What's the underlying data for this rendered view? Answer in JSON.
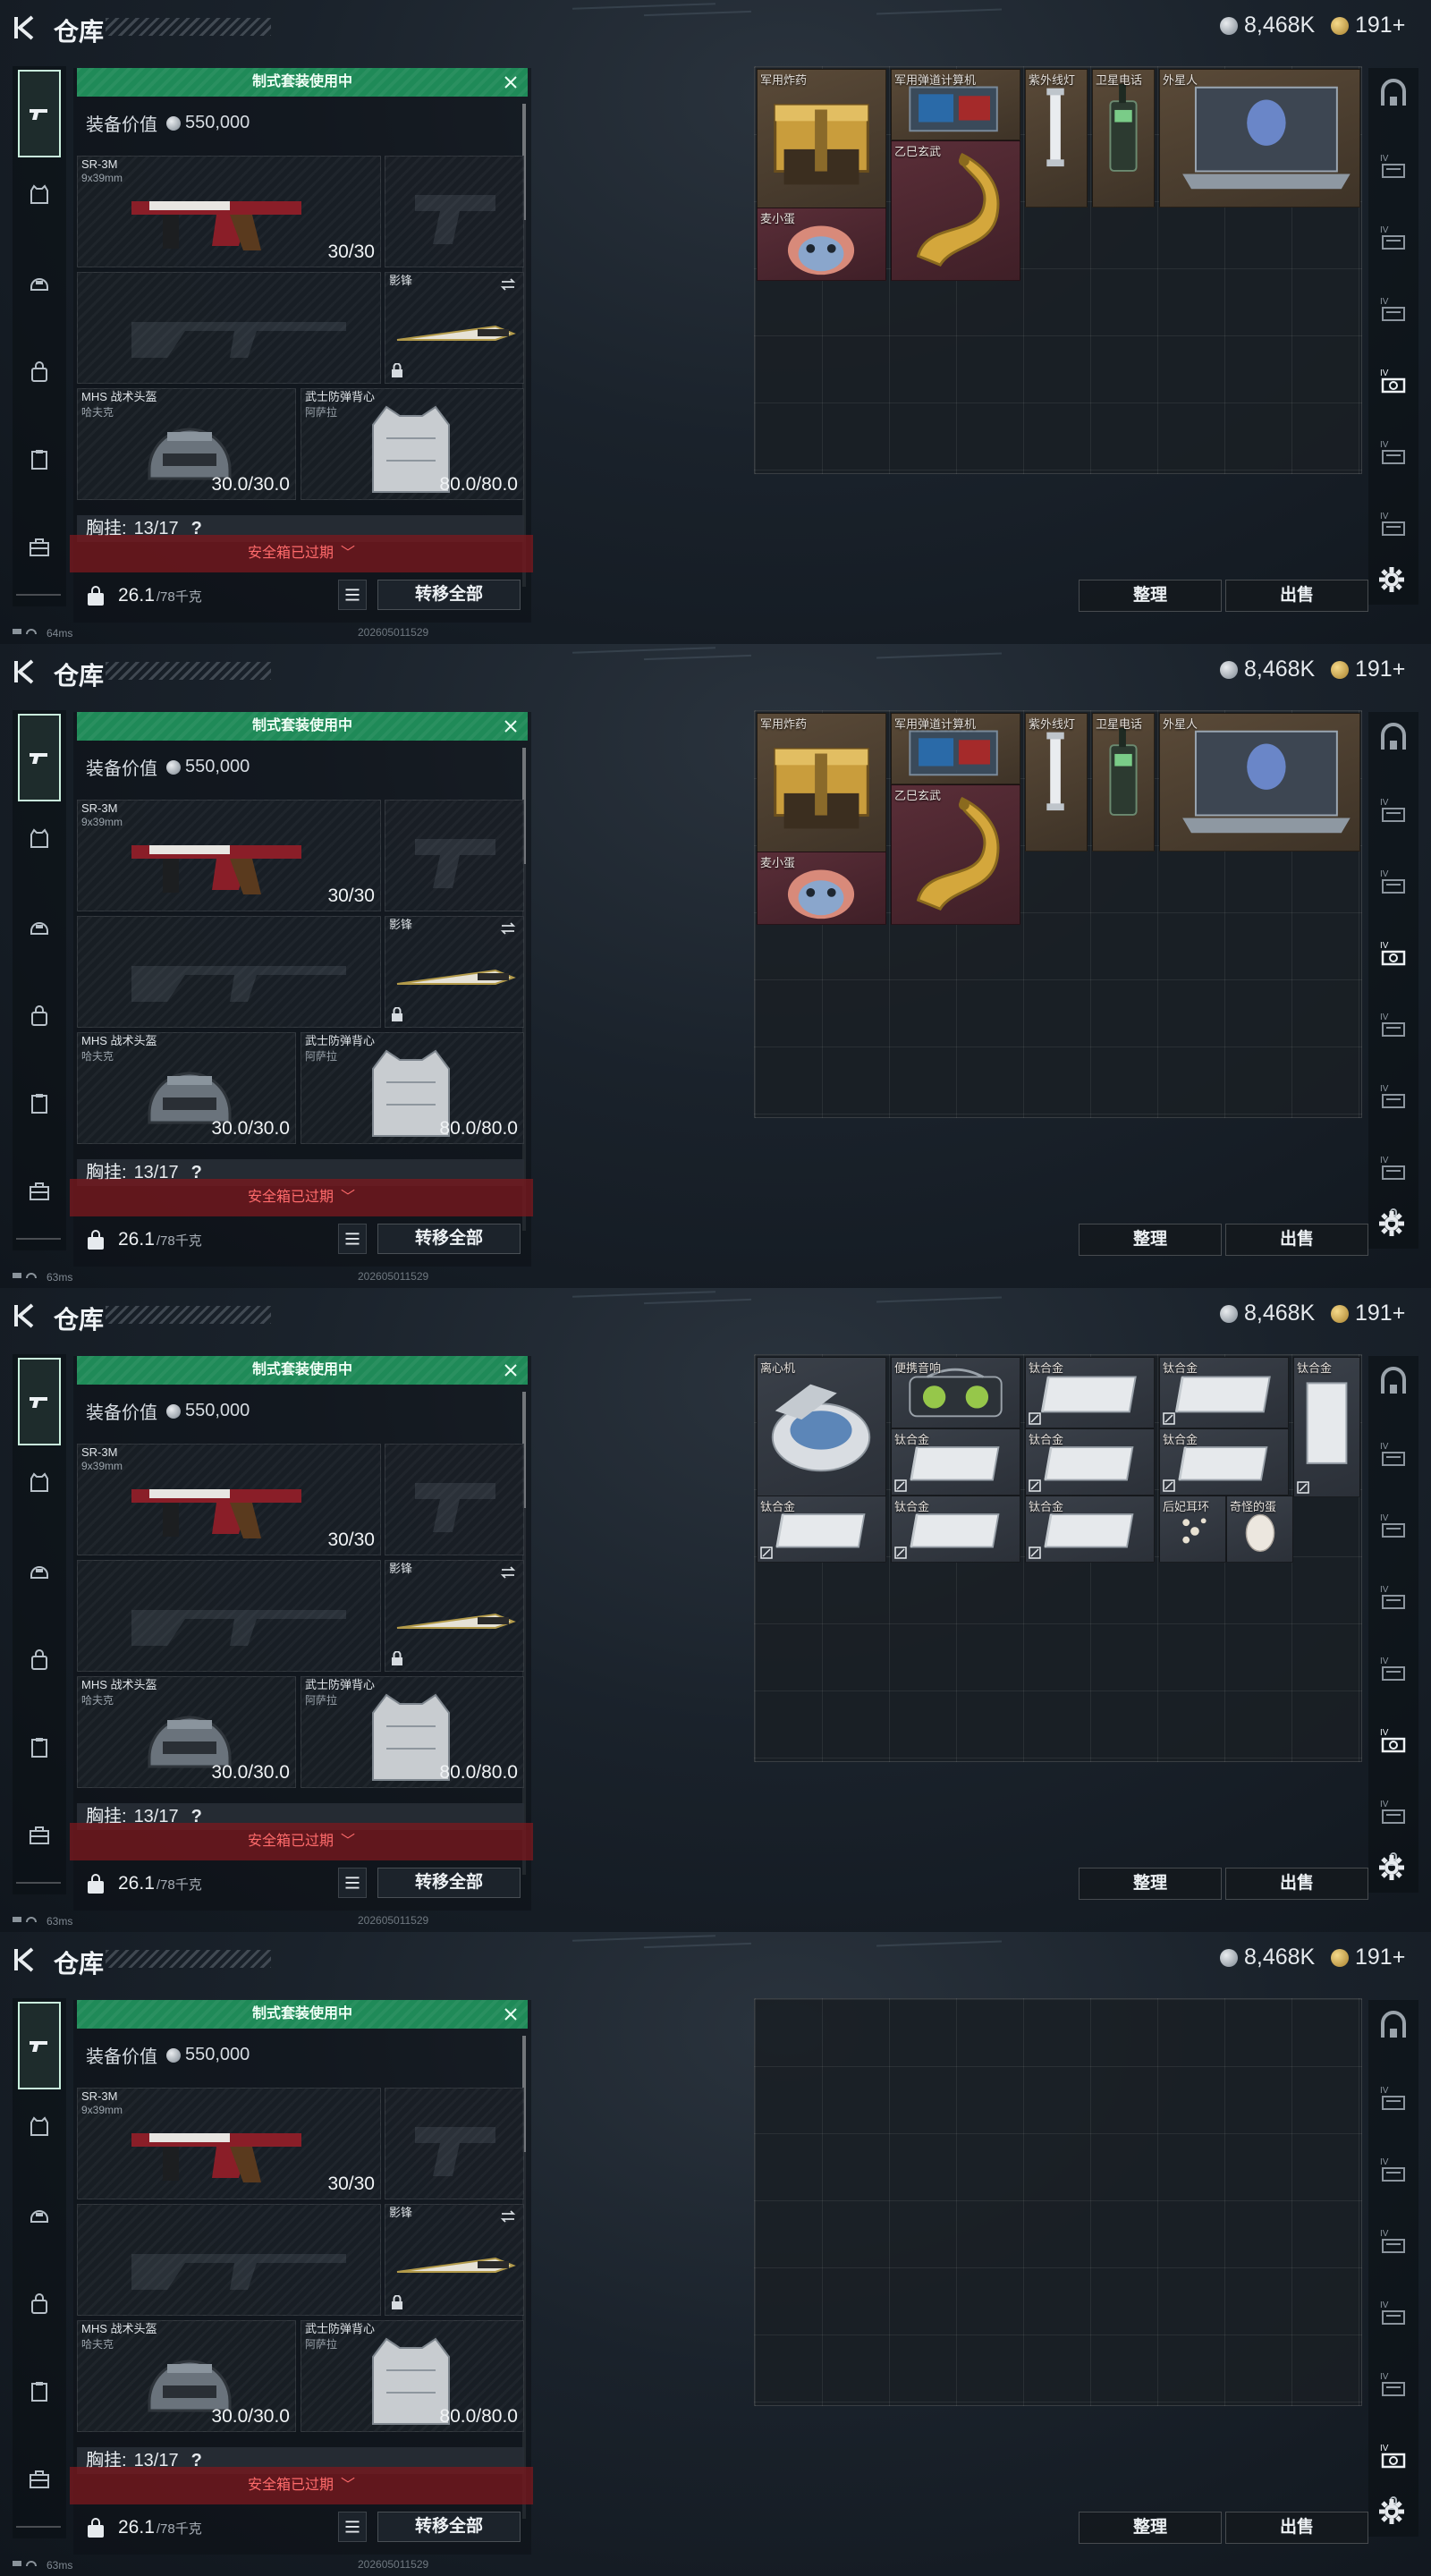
{
  "frames": [
    {
      "header": {
        "title": "仓库",
        "currency_silver": "8,468K",
        "currency_gold": "191+"
      },
      "loadout": {
        "banner": "制式套装使用中",
        "value_label": "装备价值",
        "value": "550,000",
        "primary": {
          "name": "SR-3M",
          "caliber": "9x39mm",
          "ammo": "30/30"
        },
        "melee": {
          "name": "影锋"
        },
        "helmet": {
          "name": "MHS 战术头盔",
          "sub": "哈夫克",
          "durability": "30.0/30.0"
        },
        "armor": {
          "name": "武士防弹背心",
          "sub": "阿萨拉",
          "durability": "80.0/80.0"
        },
        "chest": {
          "label": "胸挂:",
          "value": "13/17",
          "help": "?"
        },
        "expired": "安全箱已过期",
        "weight": "26.1",
        "weight_cap": "/78千克",
        "transfer_label": "转移全部"
      },
      "storage": {
        "sort_label": "整理",
        "sell_label": "出售",
        "items": [
          {
            "label": "军用炸药",
            "tone": "brown",
            "icon": "explosive-crate",
            "flag": false
          },
          {
            "label": "军用弹道计算机",
            "tone": "brown",
            "icon": "ballistic-computer",
            "flag": false
          },
          {
            "label": "紫外线灯",
            "tone": "brown",
            "icon": "uv-lamp",
            "flag": false
          },
          {
            "label": "卫星电话",
            "tone": "brown",
            "icon": "sat-phone",
            "flag": false
          },
          {
            "label": "外星人",
            "tone": "brown",
            "icon": "laptop",
            "flag": false
          },
          {
            "label": "乙巳玄武",
            "tone": "red",
            "icon": "gold-dragon",
            "flag": false
          },
          {
            "label": "麦小蛋",
            "tone": "red",
            "icon": "egg-plush",
            "flag": false
          }
        ]
      },
      "status": {
        "ping": "64ms",
        "build": "202605011529"
      }
    },
    {
      "header": {
        "title": "仓库",
        "currency_silver": "8,468K",
        "currency_gold": "191+"
      },
      "loadout": {
        "banner": "制式套装使用中",
        "value_label": "装备价值",
        "value": "550,000",
        "primary": {
          "name": "SR-3M",
          "caliber": "9x39mm",
          "ammo": "30/30"
        },
        "melee": {
          "name": "影锋"
        },
        "helmet": {
          "name": "MHS 战术头盔",
          "sub": "哈夫克",
          "durability": "30.0/30.0"
        },
        "armor": {
          "name": "武士防弹背心",
          "sub": "阿萨拉",
          "durability": "80.0/80.0"
        },
        "chest": {
          "label": "胸挂:",
          "value": "13/17",
          "help": "?"
        },
        "expired": "安全箱已过期",
        "weight": "26.1",
        "weight_cap": "/78千克",
        "transfer_label": "转移全部"
      },
      "storage": {
        "sort_label": "整理",
        "sell_label": "出售",
        "items": [
          {
            "label": "军用炸药",
            "tone": "brown",
            "icon": "explosive-crate",
            "flag": false
          },
          {
            "label": "军用弹道计算机",
            "tone": "brown",
            "icon": "ballistic-computer",
            "flag": false
          },
          {
            "label": "紫外线灯",
            "tone": "brown",
            "icon": "uv-lamp",
            "flag": false
          },
          {
            "label": "卫星电话",
            "tone": "brown",
            "icon": "sat-phone",
            "flag": false
          },
          {
            "label": "外星人",
            "tone": "brown",
            "icon": "laptop",
            "flag": false
          },
          {
            "label": "乙巳玄武",
            "tone": "red",
            "icon": "gold-dragon",
            "flag": false
          },
          {
            "label": "麦小蛋",
            "tone": "red",
            "icon": "egg-plush",
            "flag": false
          }
        ]
      },
      "status": {
        "ping": "63ms",
        "build": "202605011529"
      }
    },
    {
      "header": {
        "title": "仓库",
        "currency_silver": "8,468K",
        "currency_gold": "191+"
      },
      "loadout": {
        "banner": "制式套装使用中",
        "value_label": "装备价值",
        "value": "550,000",
        "primary": {
          "name": "SR-3M",
          "caliber": "9x39mm",
          "ammo": "30/30"
        },
        "melee": {
          "name": "影锋"
        },
        "helmet": {
          "name": "MHS 战术头盔",
          "sub": "哈夫克",
          "durability": "30.0/30.0"
        },
        "armor": {
          "name": "武士防弹背心",
          "sub": "阿萨拉",
          "durability": "80.0/80.0"
        },
        "chest": {
          "label": "胸挂:",
          "value": "13/17",
          "help": "?"
        },
        "expired": "安全箱已过期",
        "weight": "26.1",
        "weight_cap": "/78千克",
        "transfer_label": "转移全部"
      },
      "storage": {
        "sort_label": "整理",
        "sell_label": "出售",
        "items": [
          {
            "label": "离心机",
            "tone": "gray",
            "icon": "centrifuge",
            "flag": false
          },
          {
            "label": "便携音响",
            "tone": "gray",
            "icon": "boombox",
            "flag": false
          },
          {
            "label": "钛合金",
            "tone": "gray",
            "icon": "titanium",
            "flag": true
          },
          {
            "label": "钛合金",
            "tone": "gray",
            "icon": "titanium",
            "flag": true
          },
          {
            "label": "钛合金",
            "tone": "gray",
            "icon": "titanium-tall",
            "flag": true
          },
          {
            "label": "钛合金",
            "tone": "gray",
            "icon": "titanium",
            "flag": true
          },
          {
            "label": "钛合金",
            "tone": "gray",
            "icon": "titanium",
            "flag": true
          },
          {
            "label": "钛合金",
            "tone": "gray",
            "icon": "titanium",
            "flag": true
          },
          {
            "label": "钛合金",
            "tone": "gray",
            "icon": "titanium",
            "flag": true
          },
          {
            "label": "钛合金",
            "tone": "gray",
            "icon": "titanium",
            "flag": true
          },
          {
            "label": "钛合金",
            "tone": "gray",
            "icon": "titanium",
            "flag": true
          },
          {
            "label": "后妃耳环",
            "tone": "gray",
            "icon": "earring",
            "flag": false
          },
          {
            "label": "奇怪的蛋",
            "tone": "gray",
            "icon": "egg",
            "flag": false
          }
        ]
      },
      "status": {
        "ping": "63ms",
        "build": "202605011529"
      }
    },
    {
      "header": {
        "title": "仓库",
        "currency_silver": "8,468K",
        "currency_gold": "191+"
      },
      "loadout": {
        "banner": "制式套装使用中",
        "value_label": "装备价值",
        "value": "550,000",
        "primary": {
          "name": "SR-3M",
          "caliber": "9x39mm",
          "ammo": "30/30"
        },
        "melee": {
          "name": "影锋"
        },
        "helmet": {
          "name": "MHS 战术头盔",
          "sub": "哈夫克",
          "durability": "30.0/30.0"
        },
        "armor": {
          "name": "武士防弹背心",
          "sub": "阿萨拉",
          "durability": "80.0/80.0"
        },
        "chest": {
          "label": "胸挂:",
          "value": "13/17",
          "help": "?"
        },
        "expired": "安全箱已过期",
        "weight": "26.1",
        "weight_cap": "/78千克",
        "transfer_label": "转移全部"
      },
      "storage": {
        "sort_label": "整理",
        "sell_label": "出售",
        "items": []
      },
      "status": {
        "ping": "63ms",
        "build": "202605011529"
      }
    }
  ],
  "colors": {
    "banner_green": "#1f8a58",
    "expired_red": "#ff6b6b",
    "rarity_brown": "#5a4a38",
    "rarity_red": "#5a2e38",
    "rarity_gray": "#3a4049"
  }
}
